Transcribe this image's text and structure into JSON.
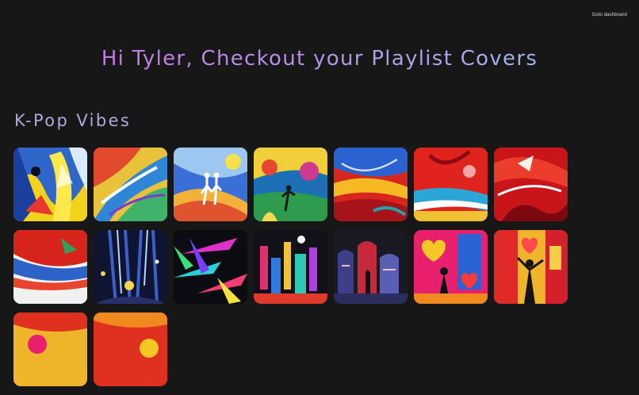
{
  "nav": {
    "dashboard_link": "Goto dashboard"
  },
  "hero": {
    "greeting": "Hi Tyler, Checkout your Playlist Covers"
  },
  "playlist": {
    "title": "K-Pop Vibes",
    "covers": [
      {
        "icon": "abstract-painting-yellow-blue"
      },
      {
        "icon": "abstract-painting-swirl"
      },
      {
        "icon": "dancing-couple-painting"
      },
      {
        "icon": "dancers-garden-painting"
      },
      {
        "icon": "red-blue-wave-painting"
      },
      {
        "icon": "red-explosion-painting"
      },
      {
        "icon": "red-abstract-painting"
      },
      {
        "icon": "red-stripe-painting"
      },
      {
        "icon": "dark-splash-painting"
      },
      {
        "icon": "neon-shards-painting"
      },
      {
        "icon": "neon-city-painting"
      },
      {
        "icon": "dark-city-painting"
      },
      {
        "icon": "hearts-city-painting"
      },
      {
        "icon": "pop-art-couple-painting"
      },
      {
        "icon": "red-yellow-painting"
      },
      {
        "icon": "red-orange-painting"
      }
    ]
  }
}
